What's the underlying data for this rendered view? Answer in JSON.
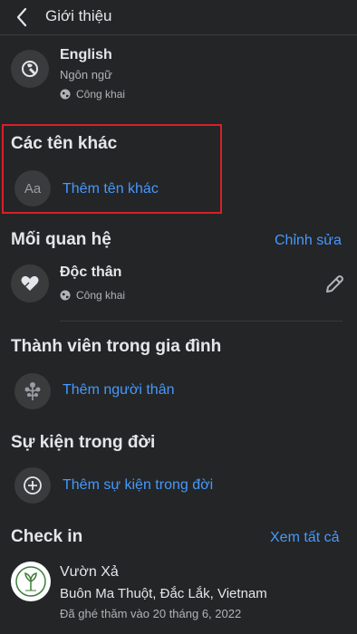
{
  "header": {
    "title": "Giới thiệu"
  },
  "language": {
    "value": "English",
    "label": "Ngôn ngữ",
    "privacy": "Công khai"
  },
  "other_names": {
    "heading": "Các tên khác",
    "add_label": "Thêm tên khác",
    "icon_text": "Aa"
  },
  "relationship": {
    "heading": "Mối quan hệ",
    "edit_label": "Chỉnh sửa",
    "status": "Độc thân",
    "privacy": "Công khai"
  },
  "family": {
    "heading": "Thành viên trong gia đình",
    "add_label": "Thêm người thân"
  },
  "life_events": {
    "heading": "Sự kiện trong đời",
    "add_label": "Thêm sự kiện trong đời"
  },
  "checkin": {
    "heading": "Check in",
    "see_all": "Xem tất cả",
    "place_name": "Vườn Xả",
    "location": "Buôn Ma Thuột, Đắc Lắk, Vietnam",
    "visited": "Đã ghé thăm vào 20 tháng 6, 2022"
  },
  "colors": {
    "background": "#242526",
    "accent": "#4599ff",
    "highlight_box": "#d7202a"
  }
}
